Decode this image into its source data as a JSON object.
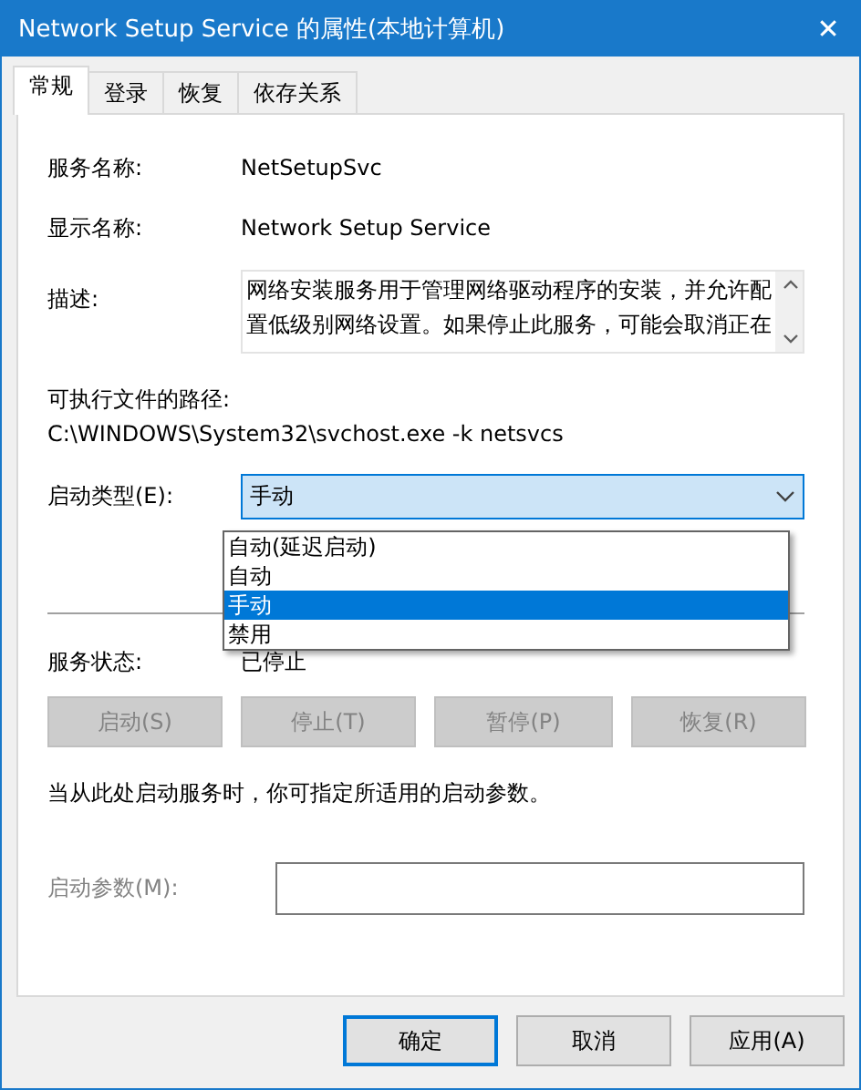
{
  "window": {
    "title": "Network Setup Service 的属性(本地计算机)",
    "close": "✕"
  },
  "tabs": [
    {
      "label": "常规",
      "selected": true
    },
    {
      "label": "登录",
      "selected": false
    },
    {
      "label": "恢复",
      "selected": false
    },
    {
      "label": "依存关系",
      "selected": false
    }
  ],
  "general": {
    "service_name": {
      "label": "服务名称:",
      "value": "NetSetupSvc"
    },
    "display_name": {
      "label": "显示名称:",
      "value": "Network Setup Service"
    },
    "description": {
      "label": "描述:",
      "value": "网络安装服务用于管理网络驱动程序的安装，并允许配置低级别网络设置。如果停止此服务，可能会取消正在"
    },
    "path": {
      "label": "可执行文件的路径:",
      "value": "C:\\WINDOWS\\System32\\svchost.exe -k netsvcs"
    },
    "startup_type": {
      "label": "启动类型(E):",
      "value": "手动",
      "expanded": true,
      "options": [
        {
          "label": "自动(延迟启动)",
          "selected": false
        },
        {
          "label": "自动",
          "selected": false
        },
        {
          "label": "手动",
          "selected": true
        },
        {
          "label": "禁用",
          "selected": false
        }
      ]
    },
    "status": {
      "label": "服务状态:",
      "value": "已停止"
    },
    "service_buttons": [
      {
        "label": "启动(S)",
        "disabled": true
      },
      {
        "label": "停止(T)",
        "disabled": true
      },
      {
        "label": "暂停(P)",
        "disabled": true
      },
      {
        "label": "恢复(R)",
        "disabled": true
      }
    ],
    "hint": "当从此处启动服务时，你可指定所适用的启动参数。",
    "start_params": {
      "label": "启动参数(M):",
      "disabled": true
    }
  },
  "buttons": [
    {
      "label": "确定",
      "default": true
    },
    {
      "label": "取消",
      "default": false
    },
    {
      "label": "应用(A)",
      "default": false
    }
  ]
}
